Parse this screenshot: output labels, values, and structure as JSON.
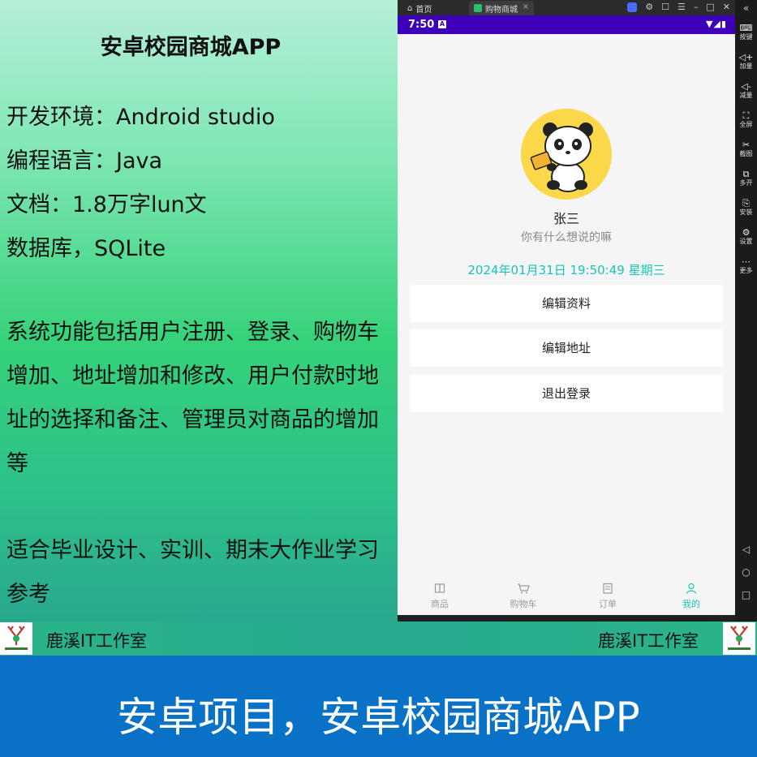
{
  "left_panel": {
    "title": "安卓校园商城APP",
    "lines": [
      "开发环境：Android studio",
      "编程语言：Java",
      "文档：1.8万字lun文",
      "数据库，SQLite"
    ],
    "features": "系统功能包括用户注册、登录、购物车增加、地址增加和修改、用户付款时地址的选择和备注、管理员对商品的增加等",
    "suitable": "适合毕业设计、实训、期末大作业学习参考"
  },
  "emulator": {
    "tabs": {
      "home": "首页",
      "app": "购物商城",
      "close": "×"
    },
    "window_controls": [
      "⚙",
      "☐",
      "☰",
      "–",
      "□",
      "✕"
    ],
    "side_toolbar": {
      "collapse": "«",
      "items": [
        {
          "icon": "⌨",
          "label": "按键"
        },
        {
          "icon": "◁+",
          "label": "加量"
        },
        {
          "icon": "◁-",
          "label": "减量"
        },
        {
          "icon": "⛶",
          "label": "全屏"
        },
        {
          "icon": "✂",
          "label": "截图"
        },
        {
          "icon": "⧉",
          "label": "多开"
        },
        {
          "icon": "⎘",
          "label": "安装"
        },
        {
          "icon": "⚙",
          "label": "设置"
        },
        {
          "icon": "⋯",
          "label": "更多"
        }
      ],
      "nav": [
        "◁",
        "○",
        "□"
      ]
    }
  },
  "phone": {
    "status": {
      "time": "7:50",
      "badge": "A",
      "icons": "▼◢▮"
    },
    "profile": {
      "name": "张三",
      "signature": "你有什么想说的嘛",
      "datetime": "2024年01月31日 19:50:49  星期三"
    },
    "menu": {
      "edit_profile": "编辑资料",
      "edit_address": "编辑地址",
      "logout": "退出登录"
    },
    "bottom_nav": [
      {
        "icon": "📖",
        "label": "商品"
      },
      {
        "icon": "🛒",
        "label": "购物车"
      },
      {
        "icon": "📋",
        "label": "订单"
      },
      {
        "icon": "👤",
        "label": "我的"
      }
    ],
    "accent_color": "#18c3b7",
    "status_bar_color": "#3d00b8"
  },
  "footer": {
    "studio_left": "鹿溪IT工作室",
    "studio_right": "鹿溪IT工作室",
    "banner": "安卓项目，安卓校园商城APP"
  }
}
